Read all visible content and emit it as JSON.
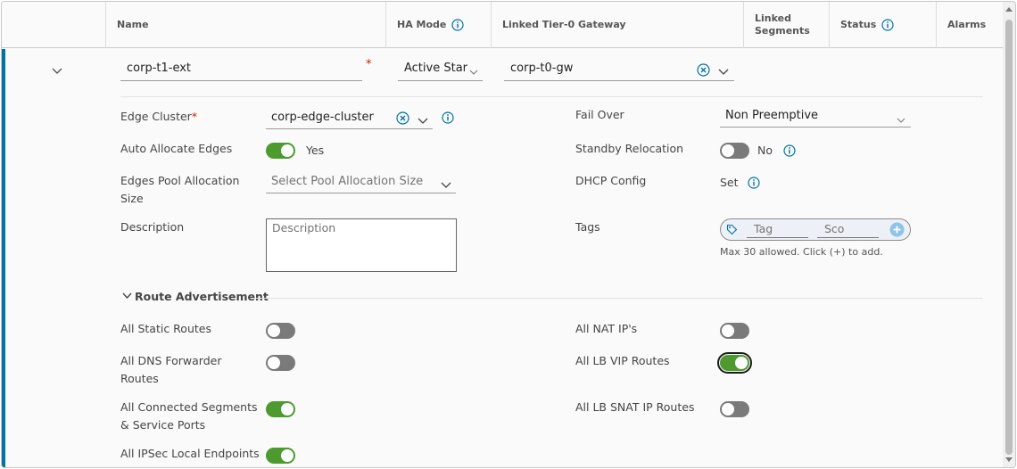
{
  "header": {
    "columns": {
      "name": "Name",
      "ha_mode": "HA Mode",
      "linked_tier0": "Linked Tier-0 Gateway",
      "linked_segments": "Linked Segments",
      "status": "Status",
      "alarms": "Alarms"
    }
  },
  "row": {
    "name_value": "corp-t1-ext",
    "ha_mode_value": "Active Star",
    "tier0_value": "corp-t0-gw"
  },
  "form": {
    "edge_cluster": {
      "label": "Edge Cluster",
      "required_mark": "*",
      "value": "corp-edge-cluster"
    },
    "auto_allocate": {
      "label": "Auto Allocate Edges",
      "state": "Yes",
      "on": true
    },
    "edges_pool": {
      "label_line1": "Edges Pool Allocation",
      "label_line2": "Size",
      "placeholder": "Select Pool Allocation Size"
    },
    "description": {
      "label": "Description",
      "placeholder": "Description"
    },
    "fail_over": {
      "label": "Fail Over",
      "value": "Non Preemptive"
    },
    "standby_relocation": {
      "label": "Standby Relocation",
      "state": "No",
      "on": false
    },
    "dhcp_config": {
      "label": "DHCP Config",
      "value": "Set"
    },
    "tags": {
      "label": "Tags",
      "tag_placeholder": "Tag",
      "scope_placeholder": "Sco",
      "hint": "Max 30 allowed. Click (+) to add."
    }
  },
  "route_advertisement": {
    "title": "Route Advertisement",
    "left": [
      {
        "label_line1": "All Static Routes",
        "label_line2": "",
        "on": false
      },
      {
        "label_line1": "All DNS Forwarder",
        "label_line2": "Routes",
        "on": false
      },
      {
        "label_line1": "All Connected Segments",
        "label_line2": "& Service Ports",
        "on": true
      },
      {
        "label_line1": "All IPSec Local Endpoints",
        "label_line2": "",
        "on": true
      }
    ],
    "right": [
      {
        "label": "All NAT IP's",
        "on": false
      },
      {
        "label": "All LB VIP Routes",
        "on": true
      },
      {
        "label": "All LB SNAT IP Routes",
        "on": false
      }
    ]
  },
  "colors": {
    "accent_blue": "#0072a3",
    "toggle_on": "#4d9a2e",
    "toggle_off": "#7a7a7a",
    "required": "#c92100"
  }
}
